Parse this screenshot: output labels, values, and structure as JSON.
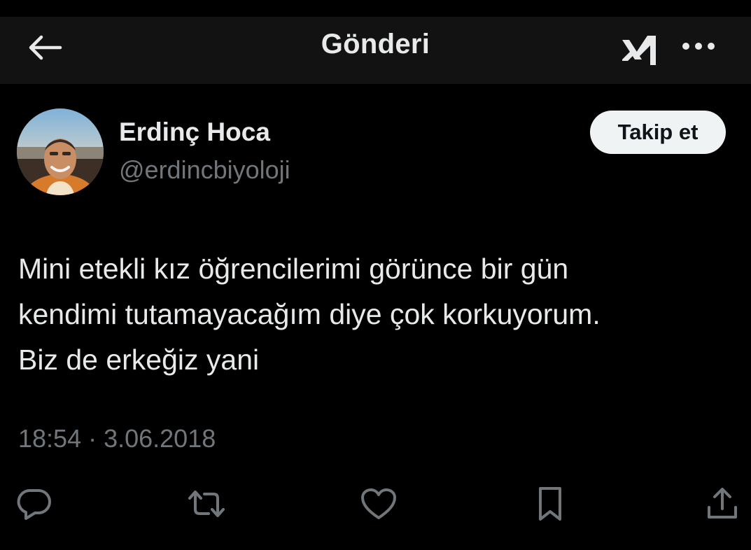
{
  "header": {
    "title": "Gönderi"
  },
  "author": {
    "display_name": "Erdinç Hoca",
    "handle": "@erdincbiyoloji",
    "follow_label": "Takip et"
  },
  "tweet": {
    "text_lines": [
      "Mini etekli kız öğrencilerimi görünce bir gün",
      "kendimi tutamayacağım diye çok korkuyorum.",
      "Biz de erkeğiz yani"
    ],
    "time": "18:54",
    "separator": " · ",
    "date": "3.06.2018"
  },
  "icons": {
    "back": "arrow-left-icon",
    "grok": "grok-logo-icon",
    "more": "more-horizontal-icon",
    "reply": "reply-bubble-icon",
    "retweet": "retweet-icon",
    "like": "heart-icon",
    "bookmark": "bookmark-icon",
    "share": "share-icon"
  },
  "colors": {
    "background": "#000000",
    "header_background": "#121212",
    "primary_text": "#e7e9ea",
    "secondary_text": "#71767b",
    "follow_button_bg": "#eff3f4",
    "follow_button_text": "#0f1419"
  }
}
